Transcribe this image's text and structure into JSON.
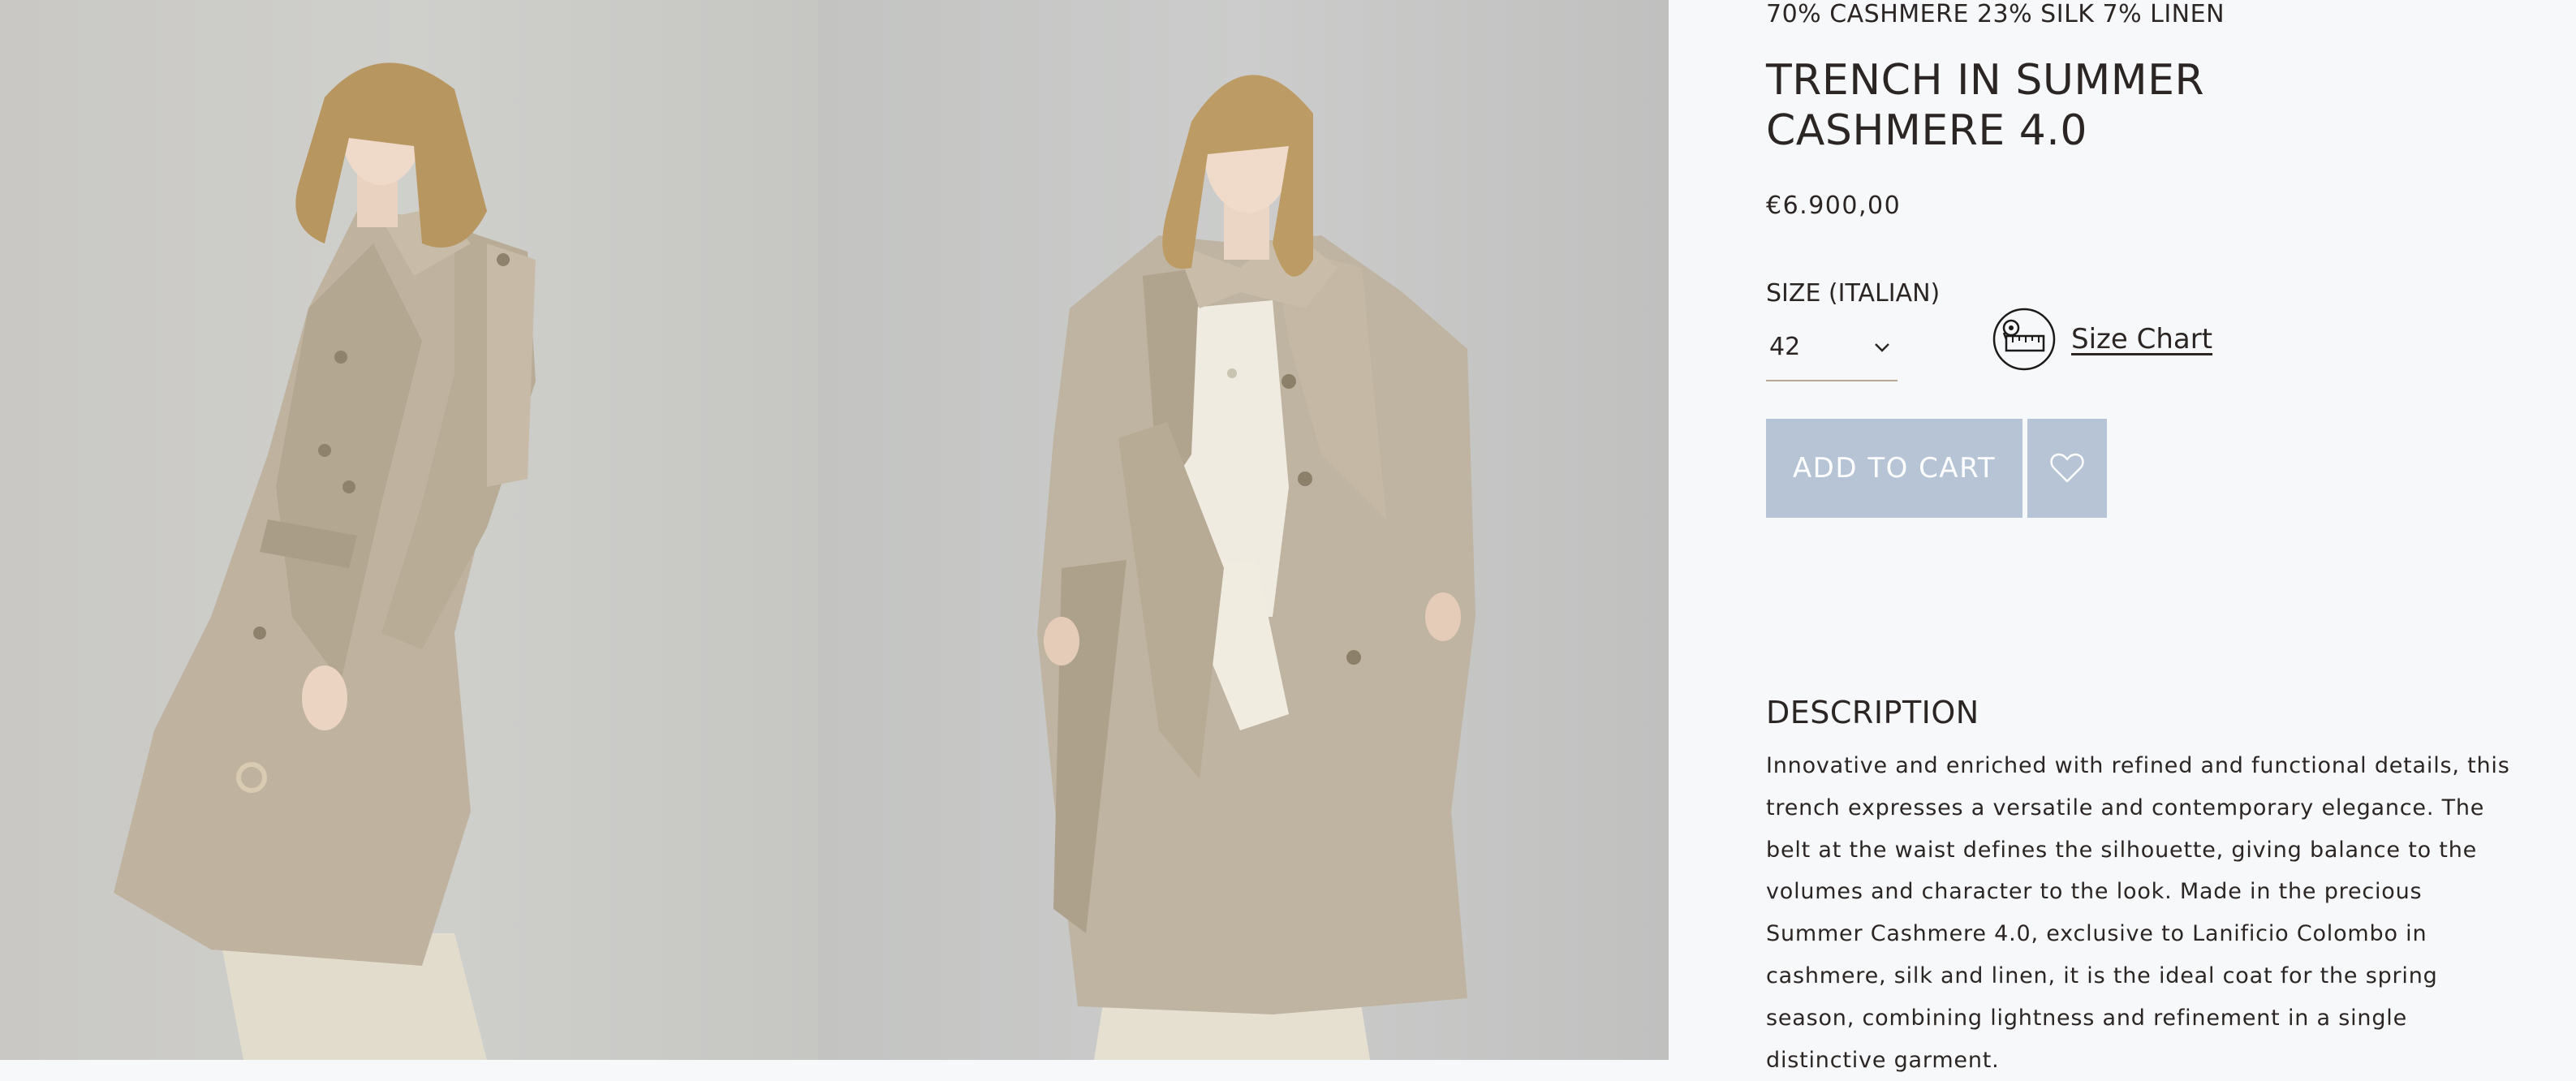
{
  "product": {
    "composition": "70% CASHMERE 23% SILK 7% LINEN",
    "title": "TRENCH IN SUMMER CASHMERE 4.0",
    "price": "€6.900,00"
  },
  "size": {
    "label": "SIZE (ITALIAN)",
    "selected": "42",
    "chart_link": "Size Chart"
  },
  "actions": {
    "add_to_cart": "ADD TO CART"
  },
  "description": {
    "heading": "DESCRIPTION",
    "text": "Innovative and enriched with refined and functional details, this trench expresses a versatile and contemporary elegance. The belt at the waist defines the silhouette, giving balance to the volumes and character to the look. Made in the precious Summer Cashmere 4.0, exclusive to Lanificio Colombo in cashmere, silk and linen, it is the ideal coat for the spring season, combining lightness and refinement in a single distinctive garment."
  },
  "icons": {
    "next": "chevron-right-icon",
    "dropdown": "chevron-down-icon",
    "size_chart": "measuring-tape-icon",
    "wishlist": "heart-icon"
  },
  "colors": {
    "button_bg": "#b6c4d6",
    "button_text": "#ffffff",
    "text": "#2b2624",
    "panel_bg": "#f7f8fa",
    "select_underline": "#b9a995"
  }
}
